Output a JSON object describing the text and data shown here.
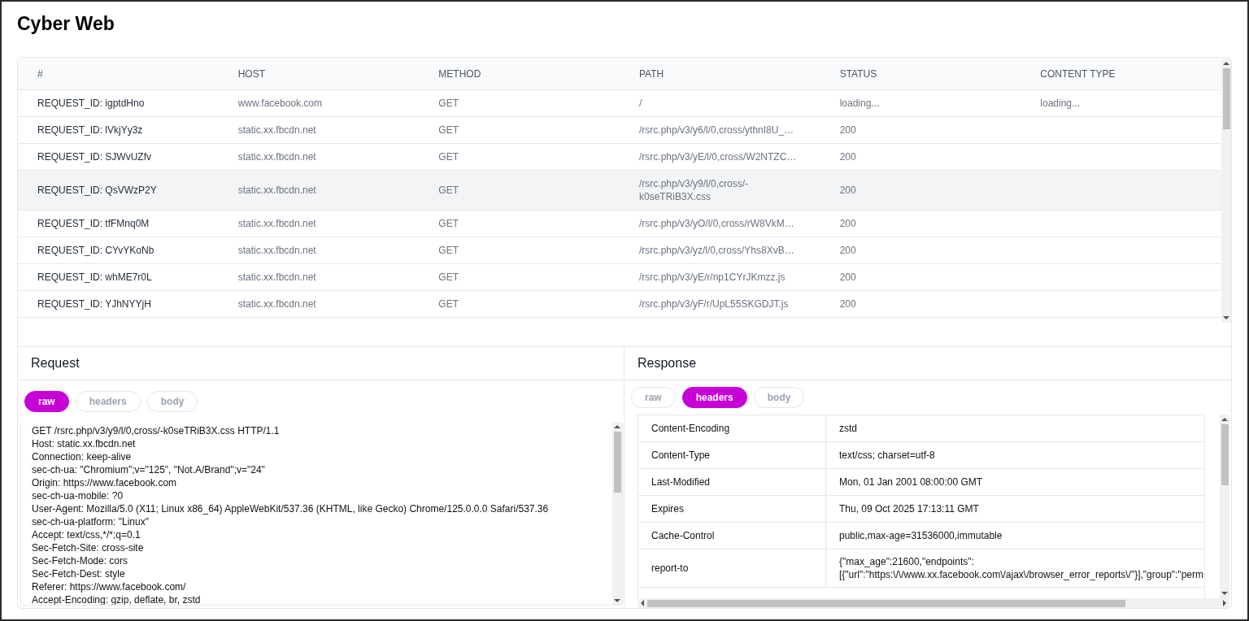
{
  "title": "Cyber Web",
  "table": {
    "columns": [
      "#",
      "HOST",
      "METHOD",
      "PATH",
      "STATUS",
      "CONTENT TYPE"
    ],
    "rows": [
      {
        "cells": [
          "REQUEST_ID: igptdHno",
          "www.facebook.com",
          "GET",
          "/",
          "loading...",
          "loading..."
        ],
        "selected": false
      },
      {
        "cells": [
          "REQUEST_ID: lVkjYy3z",
          "static.xx.fbcdn.net",
          "GET",
          "/rsrc.php/v3/y6/l/0,cross/ythnI8U_…",
          "200"
        ],
        "selected": false
      },
      {
        "cells": [
          "REQUEST_ID: SJWvUZfv",
          "static.xx.fbcdn.net",
          "GET",
          "/rsrc.php/v3/yE/l/0,cross/W2NTZC…",
          "200"
        ],
        "selected": false
      },
      {
        "cells": [
          "REQUEST_ID: QsVWzP2Y",
          "static.xx.fbcdn.net",
          "GET",
          "/rsrc.php/v3/y9/l/0,cross/-k0seTRiB3X.css",
          "200"
        ],
        "selected": true
      },
      {
        "cells": [
          "REQUEST_ID: tfFMnq0M",
          "static.xx.fbcdn.net",
          "GET",
          "/rsrc.php/v3/yO/l/0,cross/rW8VkM…",
          "200"
        ],
        "selected": false
      },
      {
        "cells": [
          "REQUEST_ID: CYvYKoNb",
          "static.xx.fbcdn.net",
          "GET",
          "/rsrc.php/v3/yz/l/0,cross/Yhs8XvB…",
          "200"
        ],
        "selected": false
      },
      {
        "cells": [
          "REQUEST_ID: whME7r0L",
          "static.xx.fbcdn.net",
          "GET",
          "/rsrc.php/v3/yE/r/np1CYrJKmzz.js",
          "200"
        ],
        "selected": false
      },
      {
        "cells": [
          "REQUEST_ID: YJhNYYjH",
          "static.xx.fbcdn.net",
          "GET",
          "/rsrc.php/v3/yF/r/UpL55SKGDJT.js",
          "200"
        ],
        "selected": false
      }
    ]
  },
  "request": {
    "title": "Request",
    "tabs": [
      {
        "label": "raw",
        "selected": true
      },
      {
        "label": "headers",
        "selected": false
      },
      {
        "label": "body",
        "selected": false
      }
    ],
    "raw_lines": [
      "GET /rsrc.php/v3/y9/l/0,cross/-k0seTRiB3X.css HTTP/1.1",
      "Host: static.xx.fbcdn.net",
      "Connection: keep-alive",
      "sec-ch-ua: \"Chromium\";v=\"125\", \"Not.A/Brand\";v=\"24\"",
      "Origin: https://www.facebook.com",
      "sec-ch-ua-mobile: ?0",
      "User-Agent: Mozilla/5.0 (X11; Linux x86_64) AppleWebKit/537.36 (KHTML, like Gecko) Chrome/125.0.0.0 Safari/537.36",
      "sec-ch-ua-platform: \"Linux\"",
      "Accept: text/css,*/*;q=0.1",
      "Sec-Fetch-Site: cross-site",
      "Sec-Fetch-Mode: cors",
      "Sec-Fetch-Dest: style",
      "Referer: https://www.facebook.com/",
      "Accept-Encoding: gzip, deflate, br, zstd"
    ]
  },
  "response": {
    "title": "Response",
    "tabs": [
      {
        "label": "raw",
        "selected": false
      },
      {
        "label": "headers",
        "selected": true
      },
      {
        "label": "body",
        "selected": false
      }
    ],
    "headers": [
      {
        "name": "Content-Encoding",
        "value": "zstd"
      },
      {
        "name": "Content-Type",
        "value": "text/css; charset=utf-8"
      },
      {
        "name": "Last-Modified",
        "value": "Mon, 01 Jan 2001 08:00:00 GMT"
      },
      {
        "name": "Expires",
        "value": "Thu, 09 Oct 2025 17:13:11 GMT"
      },
      {
        "name": "Cache-Control",
        "value": "public,max-age=31536000,immutable"
      },
      {
        "name": "report-to",
        "value": "{\"max_age\":21600,\"endpoints\": [{\"url\":\"https:\\/\\/www.xx.facebook.com\\/ajax\\/browser_error_reports\\/\"}],\"group\":\"perm"
      }
    ]
  }
}
